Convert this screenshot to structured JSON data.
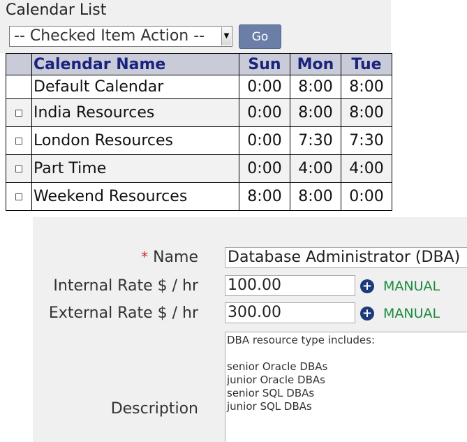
{
  "calendar_list": {
    "title": "Calendar List",
    "action_select": {
      "value": "-- Checked Item Action --",
      "arrow": "▼"
    },
    "go_label": "Go",
    "columns": {
      "name": "Calendar Name",
      "sun": "Sun",
      "mon": "Mon",
      "tue": "Tue"
    },
    "rows": [
      {
        "name": "Default Calendar",
        "sun": "0:00",
        "mon": "8:00",
        "tue": "8:00",
        "checkbox": false
      },
      {
        "name": "India Resources",
        "sun": "0:00",
        "mon": "8:00",
        "tue": "8:00",
        "checkbox": true
      },
      {
        "name": "London Resources",
        "sun": "0:00",
        "mon": "7:30",
        "tue": "7:30",
        "checkbox": true
      },
      {
        "name": "Part Time",
        "sun": "0:00",
        "mon": "4:00",
        "tue": "4:00",
        "checkbox": true
      },
      {
        "name": "Weekend Resources",
        "sun": "8:00",
        "mon": "8:00",
        "tue": "0:00",
        "checkbox": true
      }
    ]
  },
  "resource_form": {
    "required_mark": "*",
    "name_label": "Name",
    "name_value": "Database Administrator (DBA)",
    "internal_rate_label": "Internal Rate $ / hr",
    "internal_rate_value": "100.00",
    "external_rate_label": "External Rate $ / hr",
    "external_rate_value": "300.00",
    "plus_icon": "+",
    "manual_label": "MANUAL",
    "description_label": "Description",
    "description_lines": [
      "DBA resource type includes:",
      "",
      "senior Oracle DBAs",
      "junior Oracle DBAs",
      "senior SQL DBAs",
      "junior SQL DBAs"
    ]
  }
}
